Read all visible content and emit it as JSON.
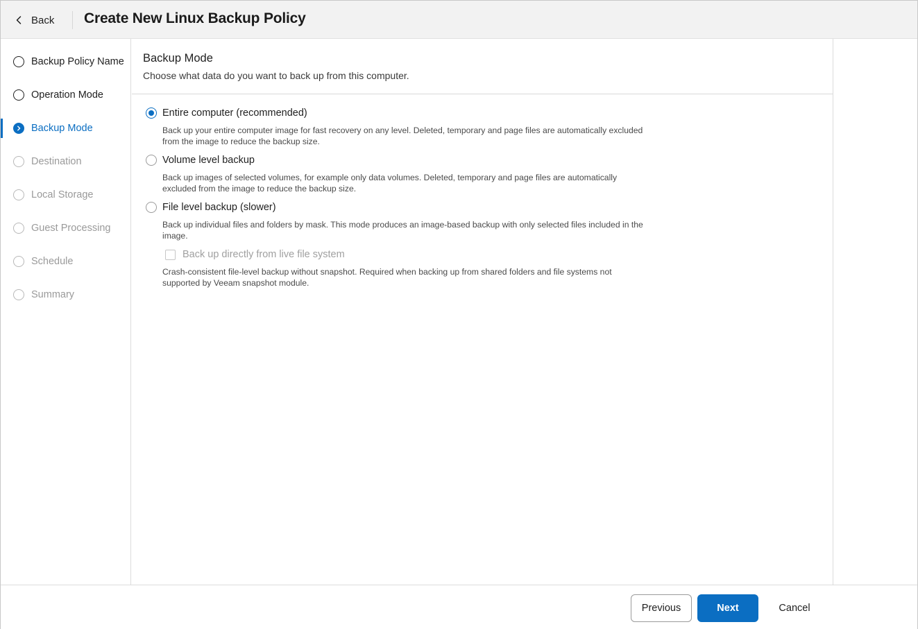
{
  "header": {
    "back_label": "Back",
    "title": "Create New Linux Backup Policy"
  },
  "sidebar": {
    "steps": [
      {
        "label": "Backup Policy Name",
        "state": "completed"
      },
      {
        "label": "Operation Mode",
        "state": "completed"
      },
      {
        "label": "Backup Mode",
        "state": "active"
      },
      {
        "label": "Destination",
        "state": "disabled"
      },
      {
        "label": "Local Storage",
        "state": "disabled"
      },
      {
        "label": "Guest Processing",
        "state": "disabled"
      },
      {
        "label": "Schedule",
        "state": "disabled"
      },
      {
        "label": "Summary",
        "state": "disabled"
      }
    ]
  },
  "main": {
    "title": "Backup Mode",
    "description": "Choose what data do you want to back up from this computer.",
    "options": [
      {
        "label": "Entire computer (recommended)",
        "checked": true,
        "description": "Back up your entire computer image for fast recovery on any level. Deleted, temporary and page files are automatically excluded from the image to reduce the backup size."
      },
      {
        "label": "Volume level backup",
        "checked": false,
        "description": "Back up images of selected volumes, for example only data volumes. Deleted, temporary and page files are automatically excluded from the image to reduce the backup size."
      },
      {
        "label": "File level backup (slower)",
        "checked": false,
        "description": "Back up individual files and folders by mask. This mode produces an image-based backup with only selected files included in the image."
      }
    ],
    "live_fs_checkbox": {
      "label": "Back up directly from live file system",
      "checked": false,
      "disabled": true,
      "description": "Crash-consistent file-level backup without snapshot. Required when backing up from shared folders and file systems not supported by Veeam snapshot module."
    }
  },
  "footer": {
    "previous_label": "Previous",
    "next_label": "Next",
    "cancel_label": "Cancel"
  },
  "colors": {
    "accent": "#0b6ec2",
    "header_bg": "#f2f2f2",
    "disabled_text": "#9a9a9a"
  }
}
